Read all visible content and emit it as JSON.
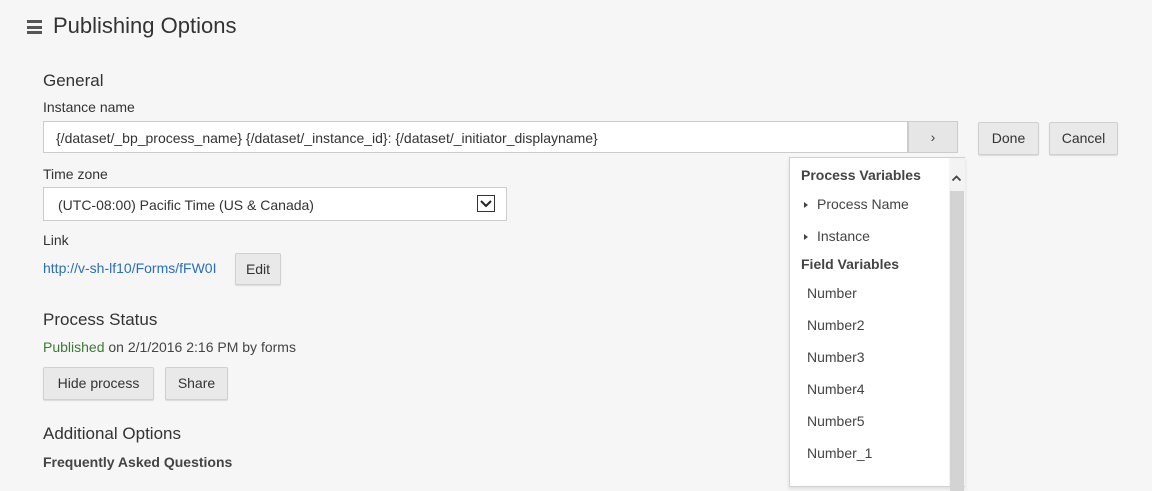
{
  "page": {
    "title": "Publishing Options"
  },
  "general": {
    "heading": "General",
    "instance_label": "Instance name",
    "instance_value": "{/dataset/_bp_process_name} {/dataset/_instance_id}: {/dataset/_initiator_displayname}",
    "arrow_label": "›",
    "done_label": "Done",
    "cancel_label": "Cancel",
    "timezone_label": "Time zone",
    "timezone_value": "(UTC-08:00) Pacific Time (US & Canada)",
    "link_label": "Link",
    "link_text": "http://v-sh-lf10/Forms/fFW0I",
    "edit_label": "Edit"
  },
  "status": {
    "heading": "Process Status",
    "published_word": "Published",
    "published_detail": " on 2/1/2016 2:16 PM by forms",
    "hide_label": "Hide process",
    "share_label": "Share"
  },
  "additional": {
    "heading": "Additional Options",
    "faq_label": "Frequently Asked Questions"
  },
  "dropdown": {
    "group1": "Process Variables",
    "process_items": [
      "Process Name",
      "Instance"
    ],
    "group2": "Field Variables",
    "field_items": [
      "Number",
      "Number2",
      "Number3",
      "Number4",
      "Number5",
      "Number_1"
    ]
  },
  "colors": {
    "link": "#2a6ebb",
    "published": "#3c7a34"
  }
}
